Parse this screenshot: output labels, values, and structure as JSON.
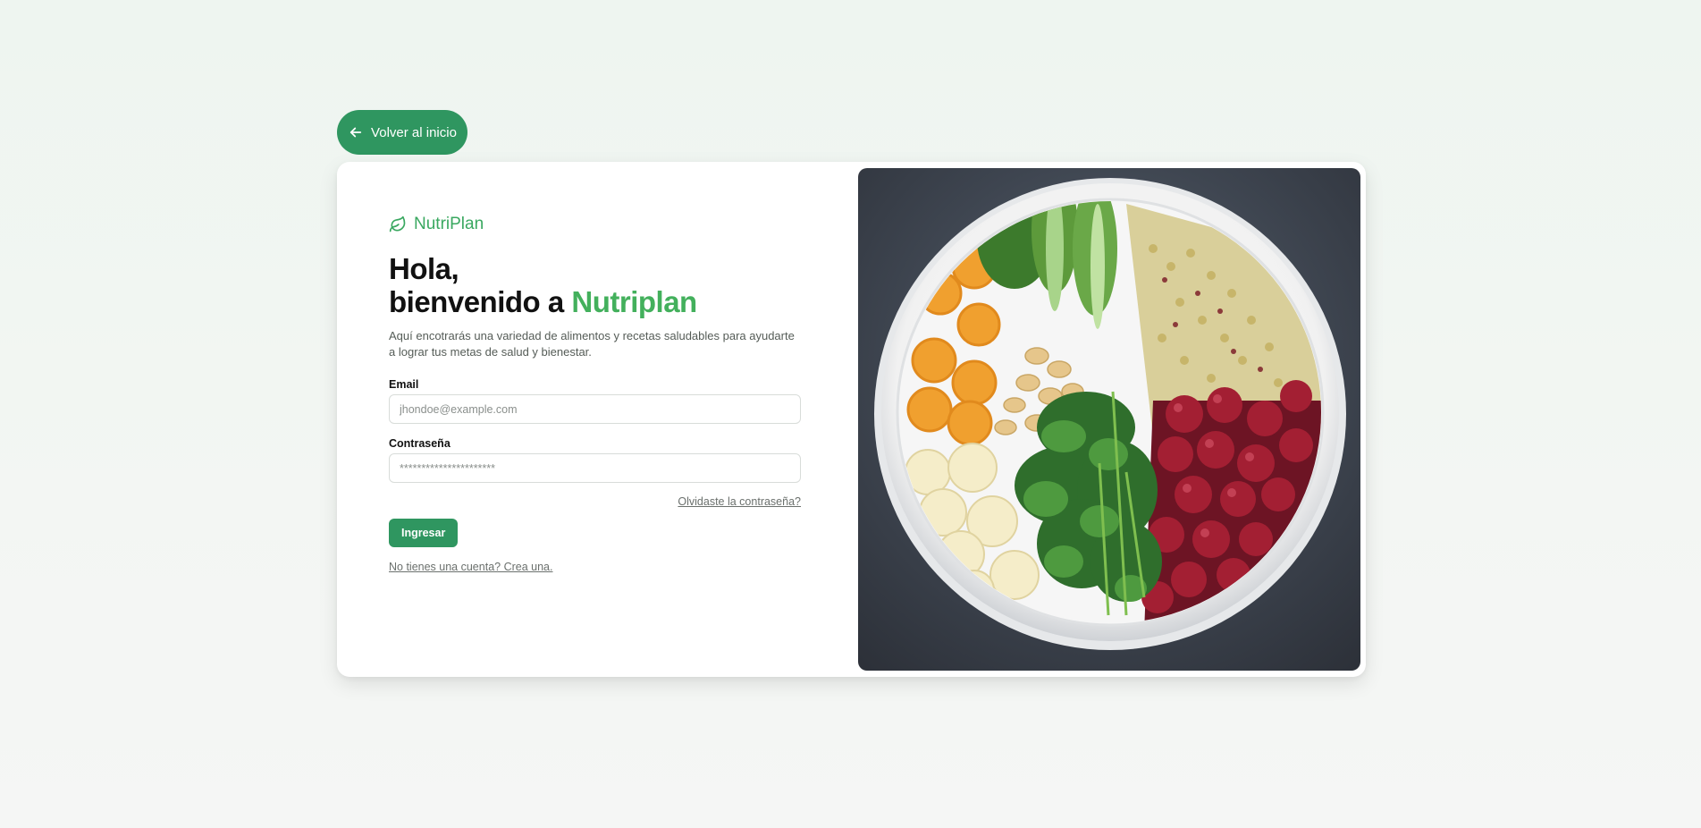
{
  "back_button": {
    "label": "Volver al inicio",
    "icon": "arrow-left-icon"
  },
  "brand": {
    "name": "NutriPlan",
    "icon": "leaf-icon",
    "color": "#3aa860"
  },
  "heading": {
    "line1": "Hola,",
    "line2_prefix": "bienvenido a ",
    "line2_accent": "Nutriplan"
  },
  "subtitle": "Aquí encotrarás una variedad de alimentos y recetas saludables para ayudarte a lograr tus metas de salud y bienestar.",
  "form": {
    "email_label": "Email",
    "email_placeholder": "jhondoe@example.com",
    "password_label": "Contraseña",
    "password_placeholder": "**********************",
    "forgot_link": "Olvidaste la contraseña?",
    "submit_label": "Ingresar",
    "signup_link": "No tienes una cuenta? Crea una."
  },
  "colors": {
    "primary": "#2f9660",
    "accent": "#43b05c",
    "background": "#f1f6f2"
  },
  "hero_image": {
    "subject": "food-bowl-image"
  }
}
